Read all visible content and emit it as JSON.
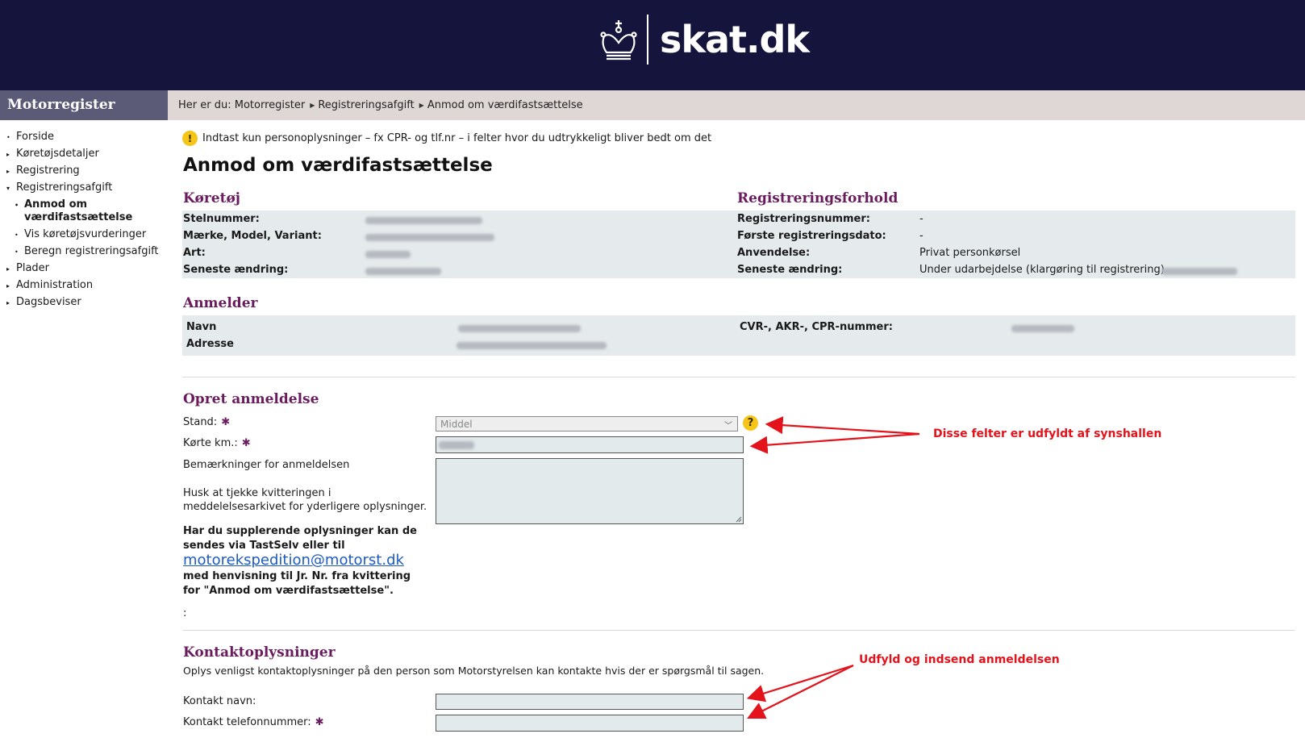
{
  "header": {
    "logo_text": "skat.dk",
    "logo_icon": "crown-icon"
  },
  "sidebar": {
    "title": "Motorregister",
    "items": [
      {
        "label": "Forside",
        "marker": "•"
      },
      {
        "label": "Køretøjsdetaljer",
        "marker": "▸"
      },
      {
        "label": "Registrering",
        "marker": "▸"
      },
      {
        "label": "Registreringsafgift",
        "marker": "▾"
      },
      {
        "label": "Anmod om værdifastsættelse",
        "marker": "•"
      },
      {
        "label": "Vis køretøjsvurderinger",
        "marker": "•"
      },
      {
        "label": "Beregn registreringsafgift",
        "marker": "•"
      },
      {
        "label": "Plader",
        "marker": "▸"
      },
      {
        "label": "Administration",
        "marker": "▸"
      },
      {
        "label": "Dagsbeviser",
        "marker": "▸"
      }
    ]
  },
  "breadcrumb": {
    "items": [
      "Her er du: Motorregister",
      "Registreringsafgift",
      "Anmod om værdifastsættelse"
    ]
  },
  "notice": "Indtast kun personoplysninger – fx CPR- og tlf.nr – i felter hvor du udtrykkeligt bliver bedt om det",
  "page_title": "Anmod om værdifastsættelse",
  "vehicle": {
    "title": "Køretøj",
    "rows": [
      {
        "label": "Stelnummer:"
      },
      {
        "label": "Mærke, Model, Variant:"
      },
      {
        "label": "Art:"
      },
      {
        "label": "Seneste ændring:"
      }
    ]
  },
  "registration": {
    "title": "Registreringsforhold",
    "rows": [
      {
        "label": "Registreringsnummer:",
        "value": "-"
      },
      {
        "label": "Første registreringsdato:",
        "value": "-"
      },
      {
        "label": "Anvendelse:",
        "value": "Privat personkørsel"
      },
      {
        "label": "Seneste ændring:",
        "value": "Under udarbejdelse (klargøring til registrering)"
      }
    ]
  },
  "applicant": {
    "title": "Anmelder",
    "name_label": "Navn",
    "address_label": "Adresse",
    "id_label": "CVR-, AKR-, CPR-nummer:"
  },
  "form": {
    "title": "Opret anmeldelse",
    "condition_label": "Stand:",
    "condition_value": "Middel",
    "km_label": "Kørte km.:",
    "remarks_label": "Bemærkninger for anmeldelsen",
    "hint_text": "Husk at tjekke kvitteringen i meddelelsesarkivet for yderligere oplysninger.",
    "supplement_text_1": "Har du supplerende oplysninger kan de sendes via TastSelv eller til",
    "email": "motorekspedition@motorst.dk",
    "supplement_text_2": "med henvisning til Jr. Nr. fra kvittering for \"Anmod om værdifastsættelse\".",
    "colon": ":",
    "required_mark": "✱",
    "help_mark": "?"
  },
  "contact": {
    "title": "Kontaktoplysninger",
    "description": "Oplys venligst kontaktoplysninger på den person som Motorstyrelsen kan kontakte hvis der er spørgsmål til sagen.",
    "name_label": "Kontakt navn:",
    "phone_label": "Kontakt telefonnummer:"
  },
  "annotations": {
    "filled_by_inspection": "Disse felter er udfyldt af synshallen",
    "fill_and_submit": "Udfyld og indsend anmeldelsen"
  },
  "colors": {
    "header": "#14143c",
    "accent": "#6a1b5e",
    "annotation": "#e3121b"
  }
}
